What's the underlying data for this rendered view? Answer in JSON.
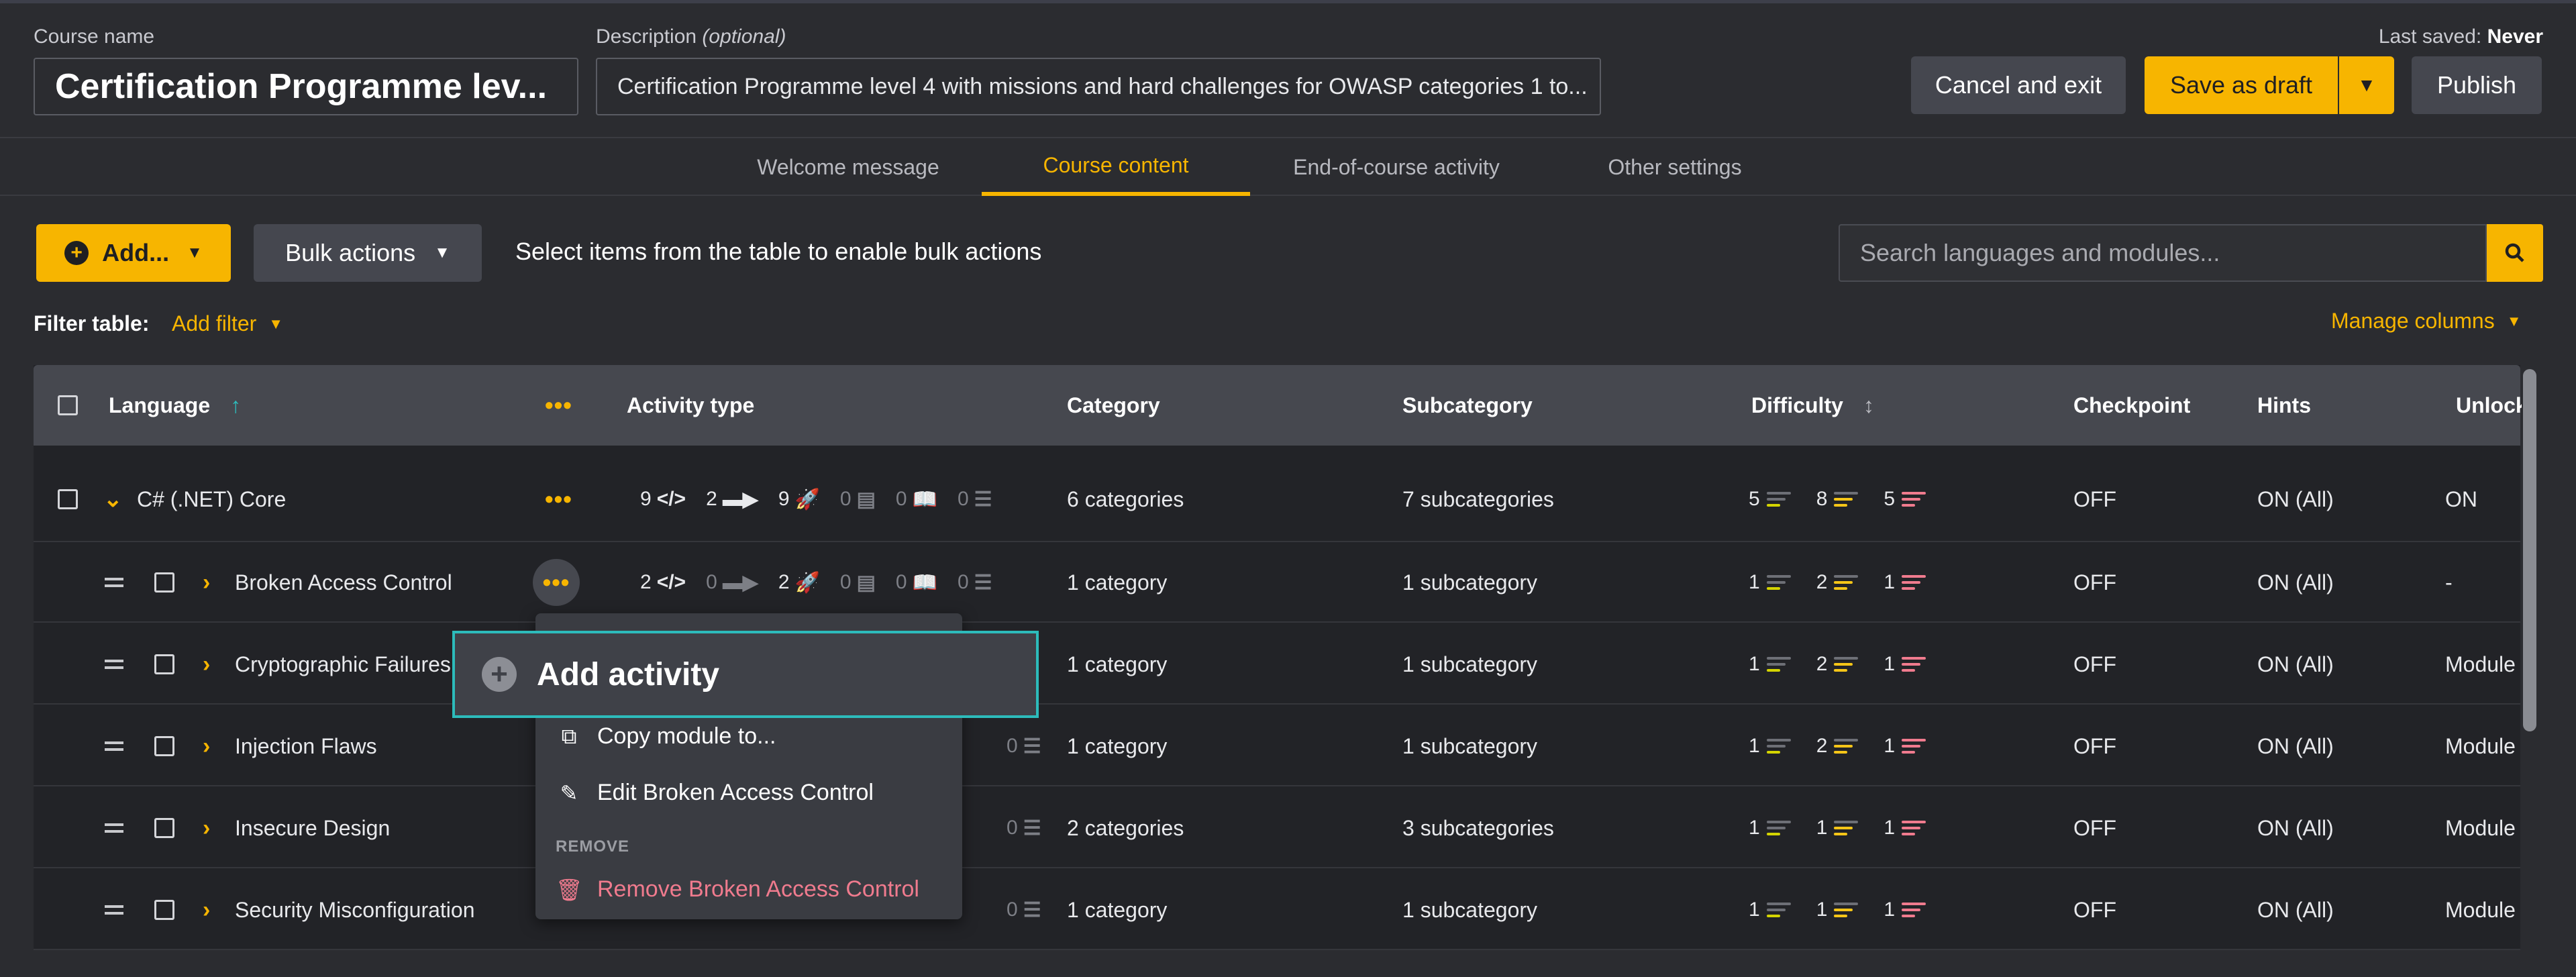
{
  "header": {
    "course_name_label": "Course name",
    "course_name_value": "Certification Programme lev...",
    "description_label": "Description",
    "description_optional": "(optional)",
    "description_value": "Certification Programme level 4 with missions and hard challenges for OWASP categories 1 to...",
    "last_saved_label": "Last saved:",
    "last_saved_value": "Never",
    "cancel_label": "Cancel and exit",
    "save_draft_label": "Save as draft",
    "publish_label": "Publish"
  },
  "tabs": [
    {
      "label": "Welcome message",
      "active": false
    },
    {
      "label": "Course content",
      "active": true
    },
    {
      "label": "End-of-course activity",
      "active": false
    },
    {
      "label": "Other settings",
      "active": false
    }
  ],
  "toolbar": {
    "add_label": "Add...",
    "bulk_label": "Bulk actions",
    "bulk_hint": "Select items from the table to enable bulk actions",
    "search_placeholder": "Search languages and modules..."
  },
  "filter": {
    "label": "Filter table:",
    "add_filter": "Add filter",
    "manage_columns": "Manage columns"
  },
  "table": {
    "columns": {
      "language": "Language",
      "activity": "Activity type",
      "category": "Category",
      "subcategory": "Subcategory",
      "difficulty": "Difficulty",
      "checkpoint": "Checkpoint",
      "hints": "Hints",
      "unlock": "Unlock"
    },
    "parent": {
      "name": "C# (.NET) Core",
      "act": [
        "9",
        "2",
        "9",
        "0",
        "0",
        "0"
      ],
      "category": "6 categories",
      "subcategory": "7 subcategories",
      "diff": [
        "5",
        "8",
        "5"
      ],
      "checkpoint": "OFF",
      "hints": "ON (All)",
      "unlock": "ON"
    },
    "rows": [
      {
        "name": "Broken Access Control",
        "act": [
          "2",
          "0",
          "2",
          "0",
          "0",
          "0"
        ],
        "category": "1 category",
        "subcategory": "1 subcategory",
        "diff": [
          "1",
          "2",
          "1"
        ],
        "checkpoint": "OFF",
        "hints": "ON (All)",
        "unlock": "-"
      },
      {
        "name": "Cryptographic Failures",
        "act": [
          "",
          "",
          "",
          "",
          "",
          ""
        ],
        "category": "1 category",
        "subcategory": "1 subcategory",
        "diff": [
          "1",
          "2",
          "1"
        ],
        "checkpoint": "OFF",
        "hints": "ON (All)",
        "unlock": "Module"
      },
      {
        "name": "Injection Flaws",
        "act": [
          "",
          "",
          "",
          "",
          "",
          "0"
        ],
        "category": "1 category",
        "subcategory": "1 subcategory",
        "diff": [
          "1",
          "2",
          "1"
        ],
        "checkpoint": "OFF",
        "hints": "ON (All)",
        "unlock": "Module"
      },
      {
        "name": "Insecure Design",
        "act": [
          "",
          "",
          "",
          "",
          "",
          "0"
        ],
        "category": "2 categories",
        "subcategory": "3 subcategories",
        "diff": [
          "1",
          "1",
          "1"
        ],
        "checkpoint": "OFF",
        "hints": "ON (All)",
        "unlock": "Module"
      },
      {
        "name": "Security Misconfiguration",
        "act": [
          "",
          "",
          "",
          "",
          "",
          "0"
        ],
        "category": "1 category",
        "subcategory": "1 subcategory",
        "diff": [
          "1",
          "1",
          "1"
        ],
        "checkpoint": "OFF",
        "hints": "ON (All)",
        "unlock": "Module"
      }
    ]
  },
  "context_menu": {
    "copy": "Copy module to...",
    "edit": "Edit Broken Access Control",
    "remove_section": "REMOVE",
    "remove": "Remove Broken Access Control"
  },
  "tooltip": {
    "label": "Add activity"
  },
  "colors": {
    "accent": "#f7b500",
    "easy": "#d4d400",
    "medium": "#f5c518",
    "hard": "#f07b8e",
    "danger": "#f07b8e",
    "focus": "#2dbbbb"
  }
}
